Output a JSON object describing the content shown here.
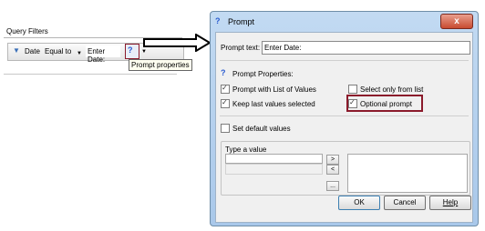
{
  "query_filters": {
    "title": "Query Filters",
    "filter": {
      "object": "Date",
      "operator": "Equal to",
      "prompt_value": "Enter Date:"
    },
    "tooltip": "Prompt properties"
  },
  "dialog": {
    "title": "Prompt",
    "close_label": "x",
    "prompt_text_label": "Prompt text:",
    "prompt_text_value": "Enter Date:",
    "properties_label": "Prompt Properties:",
    "checkboxes": {
      "prompt_with_lov": {
        "label": "Prompt with List of Values",
        "checked": true
      },
      "select_only_from_list": {
        "label": "Select only from list",
        "checked": false
      },
      "keep_last_values": {
        "label": "Keep last values selected",
        "checked": true
      },
      "optional_prompt": {
        "label": "Optional prompt",
        "checked": true
      },
      "set_default_values": {
        "label": "Set default values",
        "checked": false
      }
    },
    "type_a_value_label": "Type a value",
    "move_right": ">",
    "move_left": "<",
    "browse": "...",
    "buttons": {
      "ok": "OK",
      "cancel": "Cancel",
      "help": "Help"
    }
  },
  "colors": {
    "highlight_border": "#8b1a2b",
    "dialog_frame": "#a9c8ea",
    "accent_icon": "#2a5bd0"
  }
}
